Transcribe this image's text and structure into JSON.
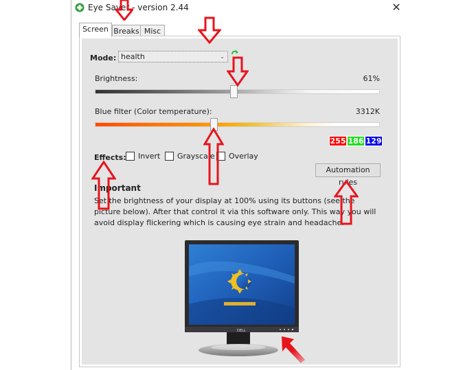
{
  "window": {
    "title": "Eye Saver - version 2.44",
    "close_label": "✕"
  },
  "tabs": [
    {
      "label": "Screen",
      "active": true
    },
    {
      "label": "Breaks",
      "active": false
    },
    {
      "label": "Misc",
      "active": false
    }
  ],
  "screen": {
    "mode_label": "Mode:",
    "mode_value": "health",
    "brightness_label": "Brightness:",
    "brightness_value": "61%",
    "brightness_fraction": 0.49,
    "blue_filter_label": "Blue filter (Color temperature):",
    "blue_filter_value": "3312K",
    "blue_filter_fraction": 0.42,
    "rgb": {
      "r": "255",
      "g": "186",
      "b": "129"
    },
    "colors": {
      "r": "#ff0000",
      "g": "#22dd22",
      "b": "#0000ee"
    },
    "effects_label": "Effects:",
    "effects": [
      {
        "label": "Invert",
        "checked": false
      },
      {
        "label": "Grayscale",
        "checked": false
      },
      {
        "label": "Overlay",
        "checked": false
      }
    ],
    "automation_button": "Automation rules",
    "important_title": "Important",
    "important_text": "Set the brightness of your display at 100% using its buttons (see the picture below). After that control it via this software only. This way you will avoid display flickering which is causing eye strain and headache.",
    "monitor_brand": "DELL"
  },
  "annotation_color": "#e8141c"
}
